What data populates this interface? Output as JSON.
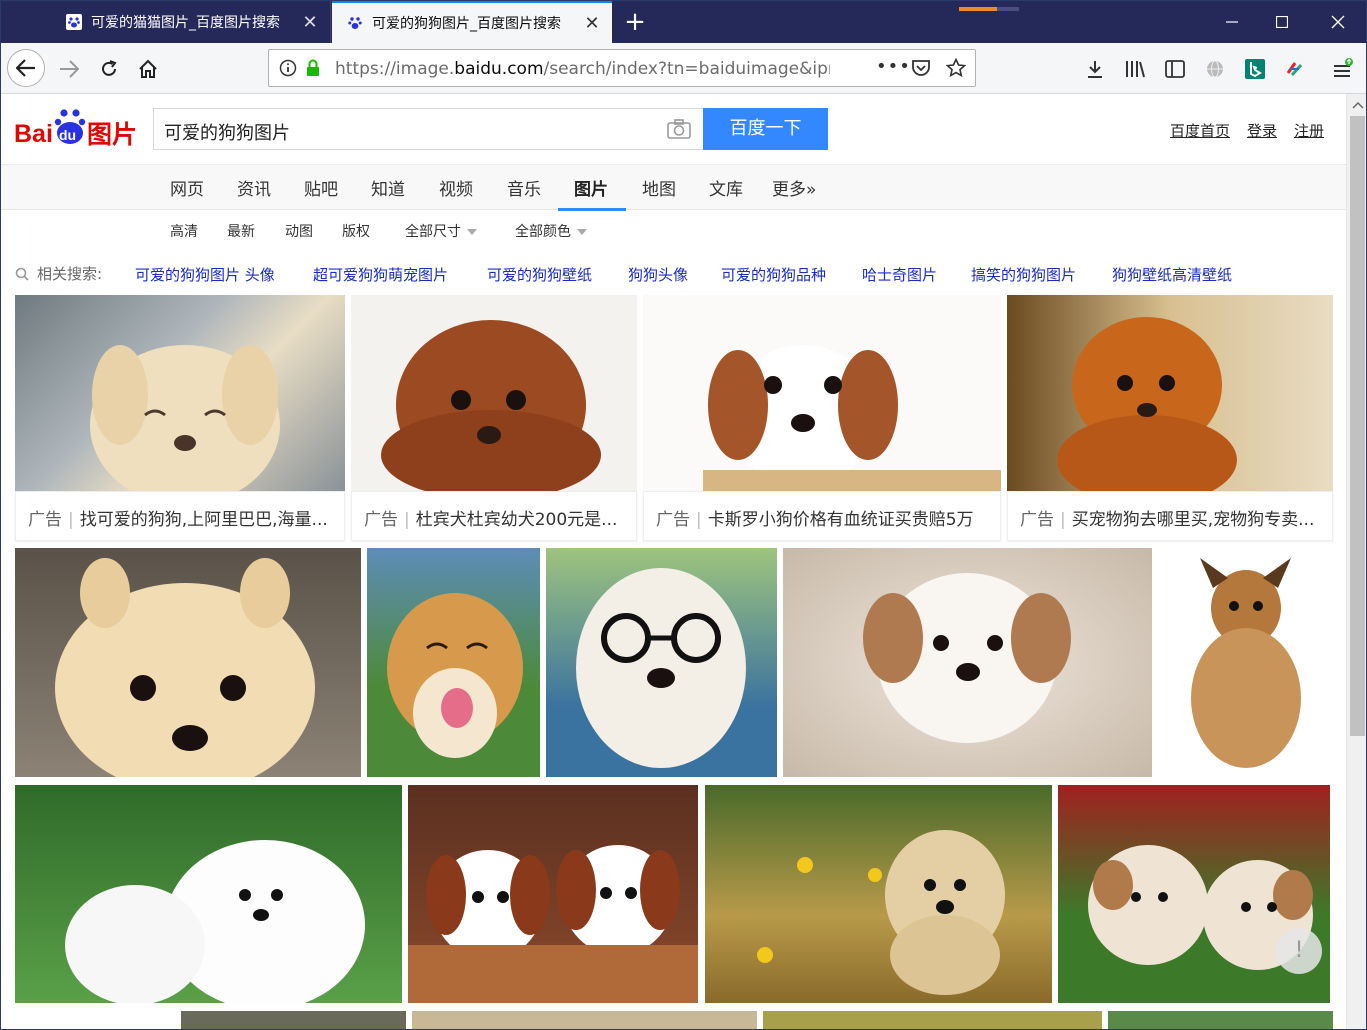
{
  "browser": {
    "tabs": [
      {
        "label": "可爱的猫猫图片_百度图片搜索",
        "active": false
      },
      {
        "label": "可爱的狗狗图片_百度图片搜索",
        "active": true
      }
    ],
    "url_prefix": "https://image.",
    "url_domain": "baidu.com",
    "url_rest": "/search/index?tn=baiduimage&ipn",
    "icons": {
      "back": "back-arrow-icon",
      "forward": "forward-arrow-icon",
      "reload": "reload-icon",
      "home": "home-icon",
      "lock": "lock-icon"
    },
    "accent": "#0a84ff"
  },
  "baidu": {
    "logo_text": "Bai度图片",
    "search_value": "可爱的狗狗图片",
    "search_button": "百度一下",
    "top_links": [
      "百度首页",
      "登录",
      "注册"
    ],
    "channels": [
      "网页",
      "资讯",
      "贴吧",
      "知道",
      "视频",
      "音乐",
      "图片",
      "地图",
      "文库",
      "更多»"
    ],
    "active_channel": "图片",
    "filters": [
      "高清",
      "最新",
      "动图",
      "版权",
      "全部尺寸",
      "全部颜色"
    ],
    "related_label": "相关搜索:",
    "related": [
      "可爱的狗狗图片 头像",
      "超可爱狗狗萌宠图片",
      "可爱的狗狗壁纸",
      "狗狗头像",
      "可爱的狗狗品种",
      "哈士奇图片",
      "搞笑的狗狗图片",
      "狗狗壁纸高清壁纸"
    ],
    "ads": [
      {
        "tag": "广告",
        "text": "找可爱的狗狗,上阿里巴巴,海量..."
      },
      {
        "tag": "广告",
        "text": "杜宾犬杜宾幼犬200元是..."
      },
      {
        "tag": "广告",
        "text": "卡斯罗小狗价格有血统证买贵赔5万"
      },
      {
        "tag": "广告",
        "text": "买宠物狗去哪里买,宠物狗专卖..."
      }
    ],
    "feedback_glyph": "!"
  }
}
